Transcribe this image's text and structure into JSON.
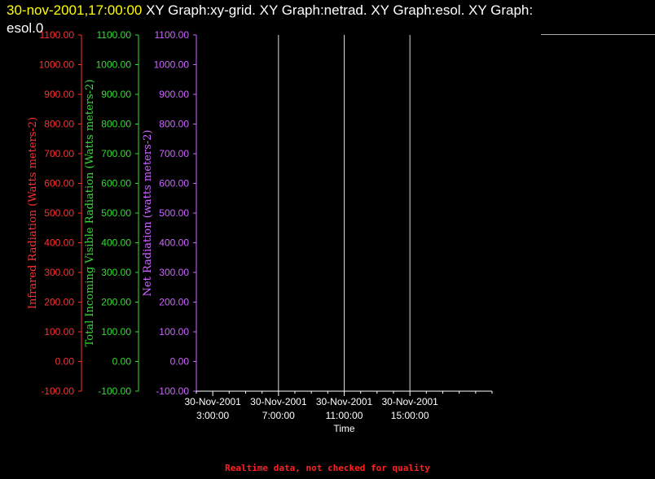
{
  "header": {
    "timestamp": "30-nov-2001,17:00:00",
    "title_rest": " XY Graph:xy-grid.  XY Graph:netrad.  XY Graph:esol.  XY Graph:",
    "title_line2": "esol.0"
  },
  "footer": {
    "note": "Realtime data, not checked for quality"
  },
  "colors": {
    "infrared": "#ff3030",
    "visible": "#33dd33",
    "netrad": "#cc66ff",
    "time_axis": "#ffffff",
    "grid": "#ffffff"
  },
  "chart_data": {
    "type": "line",
    "x_axis": {
      "label": "Time",
      "range_hours": [
        0,
        18
      ],
      "ticks": [
        {
          "hour": 1,
          "date": "30-Nov-2001",
          "time": "3:00:00"
        },
        {
          "hour": 5,
          "date": "30-Nov-2001",
          "time": "7:00:00"
        },
        {
          "hour": 9,
          "date": "30-Nov-2001",
          "time": "11:00:00"
        },
        {
          "hour": 13,
          "date": "30-Nov-2001",
          "time": "15:00:00"
        }
      ],
      "minor_ticks_hours": [
        0,
        1,
        2,
        3,
        4,
        5,
        6,
        7,
        8,
        9,
        10,
        11,
        12,
        13,
        14,
        15,
        16,
        17,
        18
      ],
      "vertical_grid_hours": [
        5,
        9,
        13
      ]
    },
    "y_axes": [
      {
        "name": "infrared",
        "label": "Infrared Radiation (Watts meters-2)",
        "range": [
          -100,
          1100
        ]
      },
      {
        "name": "visible",
        "label": "Total Incoming Visible Radiation (Watts meters-2)",
        "range": [
          -100,
          1100
        ]
      },
      {
        "name": "netrad",
        "label": "Net Radiation (watts meters-2)",
        "range": [
          -100,
          1100
        ]
      }
    ],
    "y_ticks": [
      1100,
      1000,
      900,
      800,
      700,
      600,
      500,
      400,
      300,
      200,
      100,
      0,
      -100
    ],
    "series": []
  }
}
